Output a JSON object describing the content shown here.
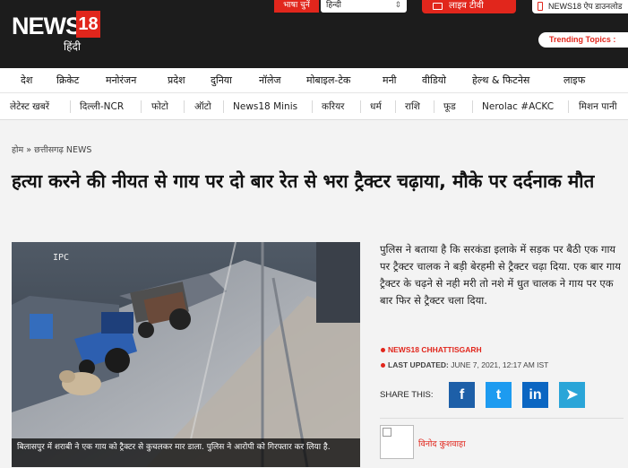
{
  "header": {
    "logo_word": "NEWS",
    "logo_number": "18",
    "logo_sub": "हिंदी",
    "language_label": "भाषा चुनें",
    "language_selected": "हिन्दी",
    "live_tv_label": "लाइव टीवी",
    "app_label": "NEWS18 ऐप डाउनलोड",
    "trending_label": "Trending Topics :"
  },
  "nav_primary": [
    "देश",
    "क्रिकेट",
    "मनोरंजन",
    "प्रदेश",
    "दुनिया",
    "नॉलेज",
    "मोबाइल-टेक",
    "मनी",
    "वीडियो",
    "हेल्थ & फिटनेस",
    "लाइफ"
  ],
  "nav_secondary": [
    "लेटेस्ट खबरें",
    "दिल्ली-NCR",
    "फोटो",
    "ऑटो",
    "News18 Minis",
    "करियर",
    "धर्म",
    "राशि",
    "फूड",
    "Nerolac #ACKC",
    "मिशन पानी"
  ],
  "breadcrumb": {
    "home": "होम",
    "separator": "»",
    "section": "छत्तीसगढ़ NEWS"
  },
  "article": {
    "title": "हत्या करने की नीयत से गाय पर दो बार रेत से भरा ट्रैक्टर चढ़ाया, मौके पर दर्दनाक मौत",
    "image_caption": "बिलासपुर में शराबी ने एक गाय को ट्रैक्टर से कुचलकर मार डाला. पुलिस ने आरोपी को गिरफ्तार कर लिया है.",
    "summary": "पुलिस ने बताया है कि सरकंडा इलाके में सड़क पर बैठी एक गाय पर ट्रैक्टर चालक ने बड़ी बेरहमी से ट्रैक्टर चढ़ा दिया. एक बार गाय ट्रैक्टर के चढ़ने से नही मरी तो नशे में धुत चालक ने गाय पर एक बार फिर से ट्रैक्टर चला दिया.",
    "source": "NEWS18 CHHATTISGARH",
    "last_updated_label": "LAST UPDATED:",
    "last_updated_value": "JUNE 7, 2021, 12:17 AM IST",
    "share_label": "SHARE THIS:",
    "author": "विनोद कुशवाहा"
  },
  "share_buttons": [
    {
      "name": "facebook",
      "glyph": "f",
      "color": "#1d5fa8"
    },
    {
      "name": "twitter",
      "glyph": "t",
      "color": "#1d9bf0"
    },
    {
      "name": "linkedin",
      "glyph": "in",
      "color": "#0b66c2"
    },
    {
      "name": "telegram",
      "glyph": "➤",
      "color": "#2aa5d8"
    }
  ],
  "colors": {
    "brand_red": "#e1261c",
    "header_bg": "#1c1c1c"
  }
}
